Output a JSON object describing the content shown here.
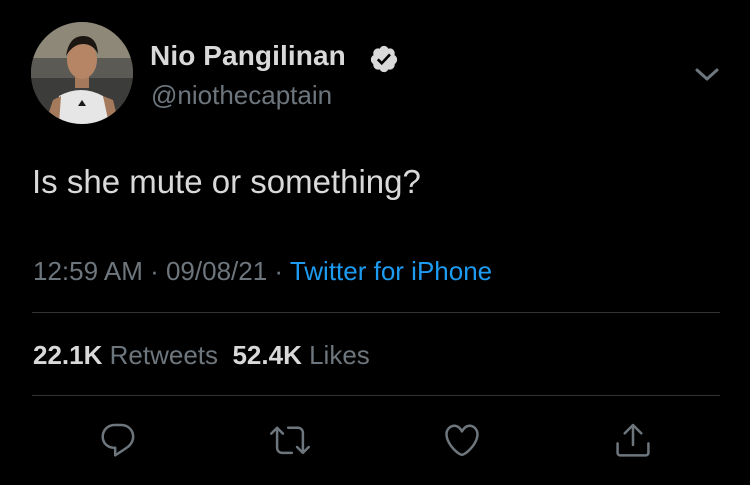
{
  "tweet": {
    "author": {
      "display_name": "Nio Pangilinan",
      "handle": "@niothecaptain",
      "verified": true
    },
    "text": "Is she mute or something?",
    "meta": {
      "time": "12:59 AM",
      "separator1": " · ",
      "date": "09/08/21",
      "separator2": " · ",
      "source": "Twitter for iPhone"
    },
    "stats": {
      "retweets_count": "22.1K",
      "retweets_label": "Retweets",
      "likes_count": "52.4K",
      "likes_label": "Likes"
    }
  },
  "icons": {
    "verified": "verified-badge-icon",
    "menu": "chevron-down-icon",
    "reply": "reply-icon",
    "retweet": "retweet-icon",
    "like": "heart-icon",
    "share": "share-icon"
  },
  "colors": {
    "background": "#000000",
    "primary_text": "#d9d9d9",
    "secondary_text": "#6e767d",
    "link": "#1d9bf0",
    "divider": "#2f3336"
  }
}
